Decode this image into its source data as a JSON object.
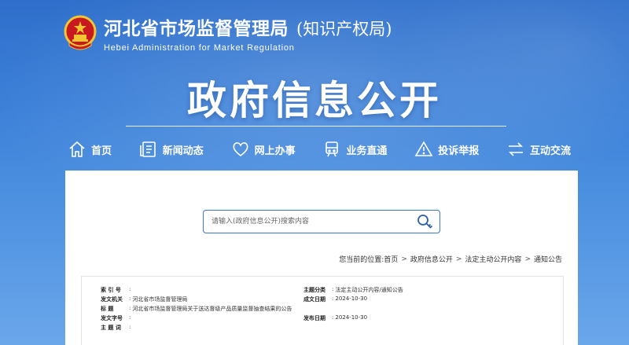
{
  "header": {
    "title_cn": "河北省市场监督管理局",
    "title_sub": "(知识产权局)",
    "title_en": "Hebei Administration for Market Regulation"
  },
  "hero": {
    "title": "政府信息公开"
  },
  "nav": {
    "items": [
      {
        "label": "首页",
        "icon": "home-icon"
      },
      {
        "label": "新闻动态",
        "icon": "news-icon"
      },
      {
        "label": "网上办事",
        "icon": "heart-icon"
      },
      {
        "label": "业务直通",
        "icon": "train-icon"
      },
      {
        "label": "投诉举报",
        "icon": "warning-icon"
      },
      {
        "label": "互动交流",
        "icon": "exchange-icon"
      }
    ]
  },
  "search": {
    "placeholder": "请输入(政府信息公开)搜索内容"
  },
  "breadcrumb": {
    "prefix": "您当前的位置:",
    "items": [
      "首页",
      "政府信息公开",
      "法定主动公开内容",
      "通知公告"
    ],
    "separator": ">"
  },
  "meta": {
    "left": [
      {
        "key": "索 引 号",
        "value": ""
      },
      {
        "key": "发文机关",
        "value": "河北省市场监督管理局"
      },
      {
        "key": "标    题",
        "value": "河北省市场监督管理局关于送达督级产品质量监督抽查结果的公告"
      },
      {
        "key": "发文字号",
        "value": ""
      },
      {
        "key": "主 题 词",
        "value": ""
      }
    ],
    "right": [
      {
        "key": "主题分类",
        "value": "法定主动公开内容/通知公告"
      },
      {
        "key": "成文日期",
        "value": "2024-10-30"
      },
      {
        "key": "发布日期",
        "value": "2024-10-30"
      }
    ]
  },
  "colors": {
    "primary": "#3b76c9",
    "header_bg": "#3a7fd8",
    "panel_bg": "#ffffff"
  }
}
